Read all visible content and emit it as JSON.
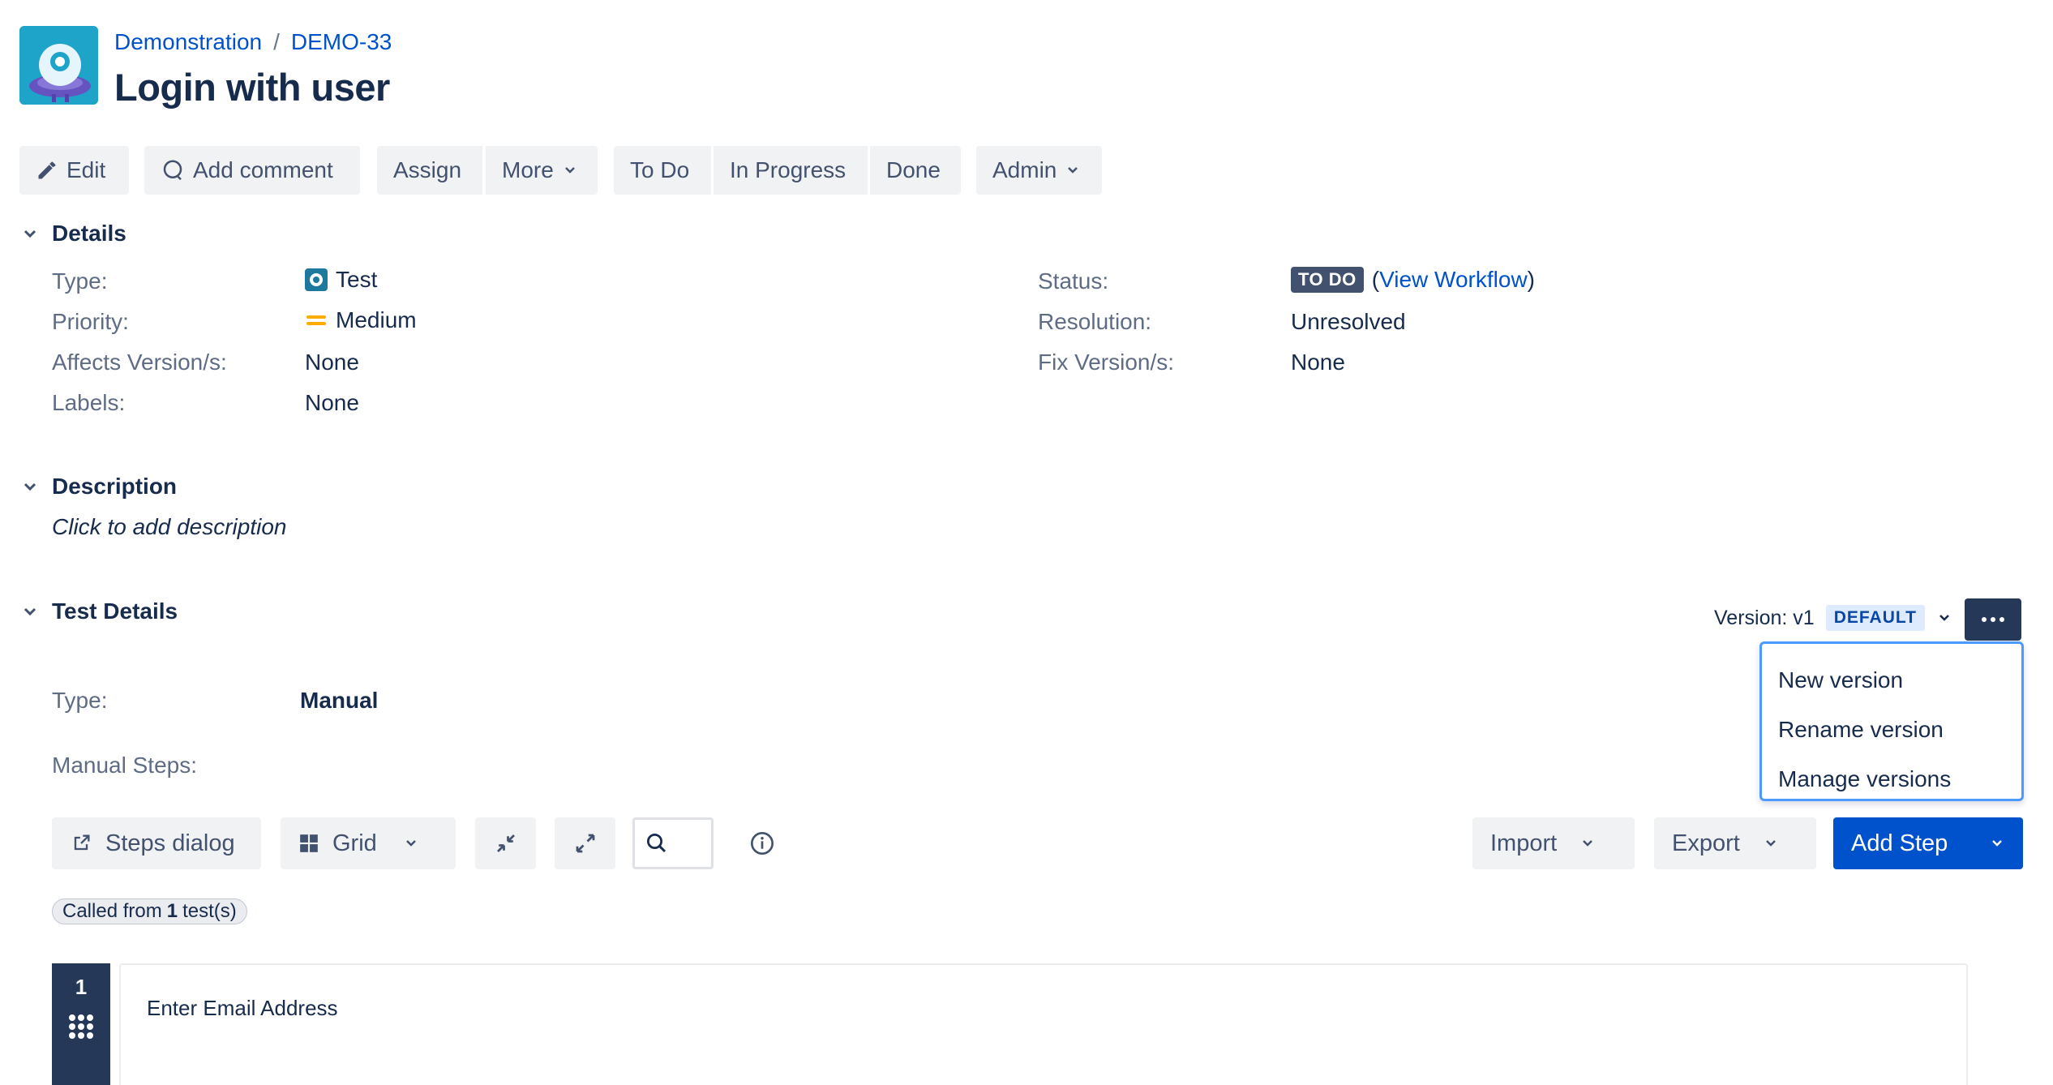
{
  "breadcrumb": {
    "project": "Demonstration",
    "separator": "/",
    "issue_key": "DEMO-33"
  },
  "issue": {
    "title": "Login with user"
  },
  "toolbar": {
    "edit": "Edit",
    "add_comment": "Add comment",
    "assign": "Assign",
    "more": "More",
    "todo": "To Do",
    "in_progress": "In Progress",
    "done": "Done",
    "admin": "Admin"
  },
  "details": {
    "heading": "Details",
    "type_label": "Type:",
    "type_value": "Test",
    "priority_label": "Priority:",
    "priority_value": "Medium",
    "affects_label": "Affects Version/s:",
    "affects_value": "None",
    "labels_label": "Labels:",
    "labels_value": "None",
    "status_label": "Status:",
    "status_value": "TO DO",
    "status_paren_open": "(",
    "view_workflow": "View Workflow",
    "status_paren_close": ")",
    "resolution_label": "Resolution:",
    "resolution_value": "Unresolved",
    "fix_label": "Fix Version/s:",
    "fix_value": "None"
  },
  "description": {
    "heading": "Description",
    "placeholder": "Click to add description"
  },
  "test_details": {
    "heading": "Test Details",
    "version_label": "Version: v1",
    "default_badge": "DEFAULT",
    "type_label": "Type:",
    "type_value": "Manual",
    "manual_steps_label": "Manual Steps:"
  },
  "version_menu": {
    "items": [
      "New version",
      "Rename version",
      "Manage versions"
    ]
  },
  "steps_toolbar": {
    "steps_dialog": "Steps dialog",
    "grid": "Grid",
    "import": "Import",
    "export": "Export",
    "add_step": "Add Step"
  },
  "called_from": {
    "prefix": "Called from",
    "count": "1",
    "suffix": "test(s)"
  },
  "steps": [
    {
      "number": "1",
      "action": "Enter Email Address"
    }
  ],
  "colors": {
    "accent": "#0052cc",
    "dark": "#253858",
    "priority": "#ffab00",
    "focus": "#4c9aff"
  }
}
